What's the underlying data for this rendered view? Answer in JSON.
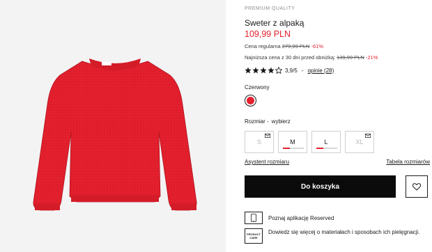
{
  "product": {
    "eyebrow": "PREMIUM QUALITY",
    "title": "Sweter z alpaką",
    "price": "109,99 PLN",
    "regular_label": "Cena regularna",
    "regular_price": "279,99 PLN",
    "regular_discount": "-61%",
    "lowest_label": "Najniższa cena z 30 dni przed obniżką:",
    "lowest_price": "139,99 PLN",
    "lowest_discount": "-21%",
    "rating_value": "3,9/5",
    "rating_separator": "-",
    "reviews_link": "opinie (28)",
    "stars_filled": 4,
    "stars_total": 5,
    "image_alt": "sweater-photo",
    "garment_color": "#e4202e"
  },
  "color": {
    "label": "Czerwony",
    "swatch": "#e4202e"
  },
  "size": {
    "label": "Rozmiar  -",
    "choose": "wybierz",
    "options": [
      {
        "label": "S",
        "available": false,
        "notify": true
      },
      {
        "label": "M",
        "available": true,
        "low_stock": true
      },
      {
        "label": "L",
        "available": true,
        "low_stock": true
      },
      {
        "label": "XL",
        "available": false,
        "notify": true
      }
    ]
  },
  "links": {
    "size_assistant": "Asystent rozmiaru",
    "size_table": "Tabela rozmiarów"
  },
  "actions": {
    "add_to_cart": "Do koszyka",
    "wishlist_icon": "heart-icon"
  },
  "promos": {
    "app_text": "Poznaj aplikację Reserved",
    "app_icon": "phone-icon",
    "care_badge": "PRODUCT CARE",
    "care_text": "Dowiedz się więcej o materiałach i sposobach ich pielęgnacji."
  },
  "colors": {
    "accent": "#e4202e",
    "button_bg": "#0b0b0b"
  }
}
